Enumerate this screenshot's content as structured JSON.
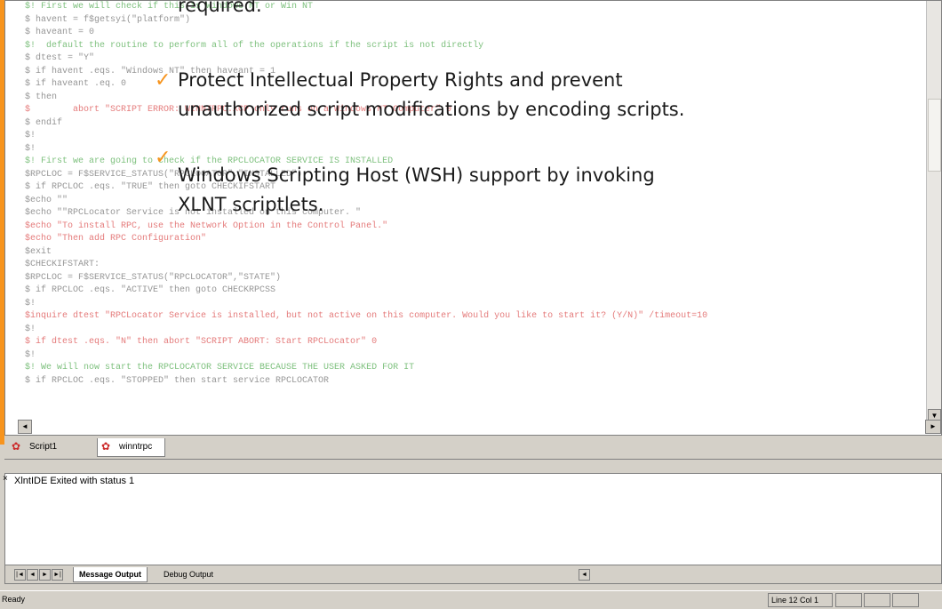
{
  "overlay": {
    "top_line": "required.",
    "bullets": [
      {
        "line1": "Protect Intellectual Property Rights and prevent",
        "line2": "unauthorized script modifications by encoding scripts."
      },
      {
        "line1": "Windows Scripting Host (WSH) support by invoking",
        "line2": "XLNT scriptlets."
      }
    ],
    "check_glyph": "✓"
  },
  "editor": {
    "lines": [
      {
        "t": "$! First we will check if this is Windows NT or Win NT",
        "c": "comment"
      },
      {
        "t": "$ havent = f$getsyi(\"platform\")",
        "c": "gray"
      },
      {
        "t": "$ haveant = 0",
        "c": "gray"
      },
      {
        "t": "$!  default the routine to perform all of the operations if the script is not directly",
        "c": "comment"
      },
      {
        "t": "$ dtest = \"Y\"",
        "c": "gray"
      },
      {
        "t": "$ if havent .eqs. \"Windows NT\" then haveant = 1",
        "c": "gray"
      },
      {
        "t": "$ if haveant .eq. 0",
        "c": "gray"
      },
      {
        "t": "$ then",
        "c": "gray"
      },
      {
        "t": "$        abort \"SCRIPT ERROR: WINNTRPC.XCP only runs on a Windows NT Computer\" 0",
        "c": "red"
      },
      {
        "t": "$ endif",
        "c": "gray"
      },
      {
        "t": "$!",
        "c": "gray"
      },
      {
        "t": "$!",
        "c": "gray"
      },
      {
        "t": "$! First we are going to check if the RPCLOCATOR SERVICE IS INSTALLED",
        "c": "comment"
      },
      {
        "t": "$RPCLOC = F$SERVICE_STATUS(\"RPCLOCATOR\",\"INSTALLED\")",
        "c": "gray"
      },
      {
        "t": "$ if RPCLOC .eqs. \"TRUE\" then goto CHECKIFSTART",
        "c": "gray"
      },
      {
        "t": "$echo \"\"",
        "c": "gray"
      },
      {
        "t": "$echo \"\"RPCLocator Service is not installed on this computer. \"",
        "c": "gray"
      },
      {
        "t": "$echo \"To install RPC, use the Network Option in the Control Panel.\"",
        "c": "red"
      },
      {
        "t": "$echo \"Then add RPC Configuration\"",
        "c": "red"
      },
      {
        "t": "$exit",
        "c": "gray"
      },
      {
        "t": "$CHECKIFSTART:",
        "c": "gray"
      },
      {
        "t": "$RPCLOC = F$SERVICE_STATUS(\"RPCLOCATOR\",\"STATE\")",
        "c": "gray"
      },
      {
        "t": "$ if RPCLOC .eqs. \"ACTIVE\" then goto CHECKRPCSS",
        "c": "gray"
      },
      {
        "t": "$!",
        "c": "gray"
      },
      {
        "t": "$inquire dtest \"RPCLocator Service is installed, but not active on this computer. Would you like to start it? (Y/N)\" /timeout=10",
        "c": "red"
      },
      {
        "t": "$!",
        "c": "gray"
      },
      {
        "t": "$ if dtest .eqs. \"N\" then abort \"SCRIPT ABORT: Start RPCLocator\" 0",
        "c": "red"
      },
      {
        "t": "$!",
        "c": "gray"
      },
      {
        "t": "$! We will now start the RPCLOCATOR SERVICE BECAUSE THE USER ASKED FOR IT",
        "c": "comment"
      },
      {
        "t": "$ if RPCLOC .eqs. \"STOPPED\" then start service RPCLOCATOR",
        "c": "gray"
      }
    ]
  },
  "doc_tabs": [
    {
      "label": "Script1"
    },
    {
      "label": "winntrpc"
    }
  ],
  "output": {
    "text": "XlntIDE Exited with status 1",
    "tabs": [
      {
        "label": "Message Output"
      },
      {
        "label": "Debug Output"
      }
    ]
  },
  "status": {
    "left": "Ready",
    "position": "Line 12 Col 1"
  },
  "colors": {
    "accent": "#f7941d",
    "comment": "#2f9a2f",
    "string": "#d42a2a"
  }
}
